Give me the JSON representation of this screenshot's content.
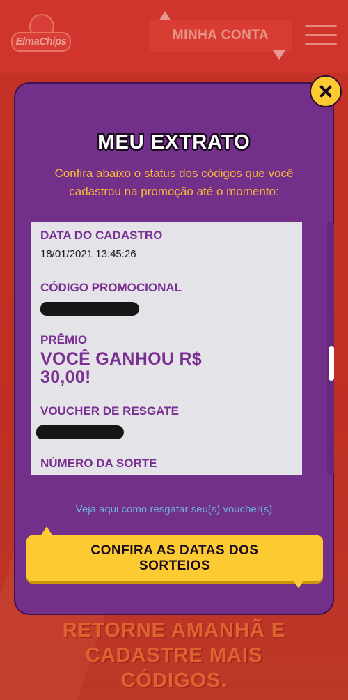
{
  "header": {
    "logo_text": "ElmaChips",
    "account_button": "MINHA CONTA"
  },
  "background": {
    "cta_lines": [
      "RETORNE AMANHÃ E",
      "CADASTRE MAIS",
      "CÓDIGOS."
    ]
  },
  "modal": {
    "title": "MEU EXTRATO",
    "description": "Confira abaixo o status dos códigos que você cadastrou na promoção até o momento:",
    "entry": {
      "date_label": "DATA DO CADASTRO",
      "date_value": "18/01/2021 13:45:26",
      "code_label": "CÓDIGO PROMOCIONAL",
      "prize_label": "PRÊMIO",
      "prize_value_line1": "VOCÊ GANHOU R$",
      "prize_value_line2": "30,00!",
      "voucher_label": "VOUCHER DE RESGATE",
      "lucky_number_label": "NÚMERO DA SORTE"
    },
    "voucher_link": "Veja aqui como resgatar seu(s) voucher(s)",
    "dates_button_line1": "CONFIRA AS DATAS DOS",
    "dates_button_line2": "SORTEIOS"
  },
  "icons": {
    "close": "close-icon",
    "menu": "hamburger-menu-icon"
  },
  "colors": {
    "modal_bg": "#72308a",
    "accent_yellow": "#fccb32",
    "label_purple": "#7a2f92",
    "link_blue": "#6fb0d8",
    "page_red": "#c8322c"
  }
}
